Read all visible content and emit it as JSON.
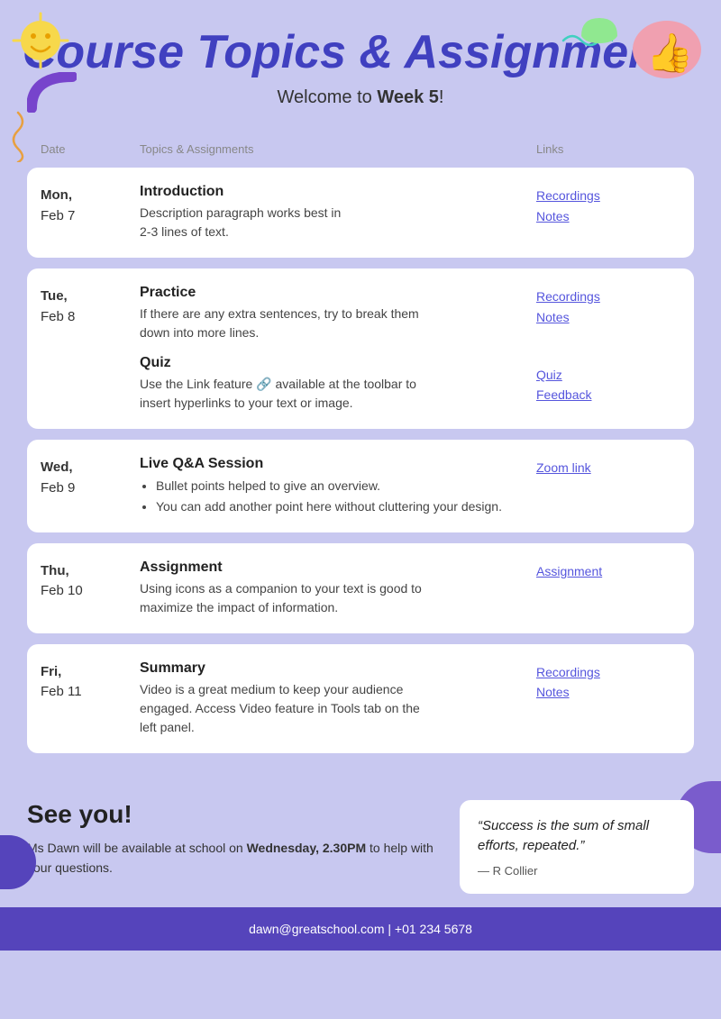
{
  "header": {
    "title": "Course Topics & Assignments",
    "subtitle_pre": "Welcome to ",
    "subtitle_week": "Week 5",
    "subtitle_post": "!"
  },
  "table": {
    "columns": {
      "date": "Date",
      "topics": "Topics & Assignments",
      "links": "Links"
    },
    "rows": [
      {
        "date_line1": "Mon,",
        "date_line2": "Feb 7",
        "sections": [
          {
            "title": "Introduction",
            "desc": "Description paragraph works best in\n2-3 lines of text.",
            "bullets": []
          }
        ],
        "link_groups": [
          {
            "links": [
              "Recordings",
              "Notes"
            ]
          }
        ]
      },
      {
        "date_line1": "Tue,",
        "date_line2": "Feb 8",
        "sections": [
          {
            "title": "Practice",
            "desc": "If there are any extra sentences, try to break them\ndown into more lines.",
            "bullets": []
          },
          {
            "title": "Quiz",
            "desc": "Use the Link feature 🔗 available at the toolbar to\ninsert hyperlinks to your text or image.",
            "bullets": []
          }
        ],
        "link_groups": [
          {
            "links": [
              "Recordings",
              "Notes"
            ]
          },
          {
            "links": [
              "Quiz",
              "Feedback"
            ]
          }
        ]
      },
      {
        "date_line1": "Wed,",
        "date_line2": "Feb 9",
        "sections": [
          {
            "title": "Live Q&A Session",
            "desc": "",
            "bullets": [
              "Bullet points helped to give an overview.",
              "You can add another point here without cluttering your design."
            ]
          }
        ],
        "link_groups": [
          {
            "links": [
              "Zoom link"
            ]
          }
        ]
      },
      {
        "date_line1": "Thu,",
        "date_line2": "Feb 10",
        "sections": [
          {
            "title": "Assignment",
            "desc": "Using icons as a companion to your text is good to\nmaximize the impact of information.",
            "bullets": []
          }
        ],
        "link_groups": [
          {
            "links": [
              "Assignment"
            ]
          }
        ]
      },
      {
        "date_line1": "Fri,",
        "date_line2": "Feb 11",
        "sections": [
          {
            "title": "Summary",
            "desc": "Video is a great medium to keep your audience\nengaged. Access Video feature in Tools tab on the\nleft panel.",
            "bullets": []
          }
        ],
        "link_groups": [
          {
            "links": [
              "Recordings",
              "Notes"
            ]
          }
        ]
      }
    ]
  },
  "bottom": {
    "see_you_title": "See you!",
    "see_you_desc_pre": "Ms Dawn will be available at school on ",
    "see_you_desc_bold": "Wednesday, 2.30PM",
    "see_you_desc_post": " to help with your questions.",
    "quote_text": "“Success is the sum of small efforts, repeated.”",
    "quote_author": "— R Collier"
  },
  "footer": {
    "contact": "dawn@greatschool.com  |  +01 234 5678"
  }
}
